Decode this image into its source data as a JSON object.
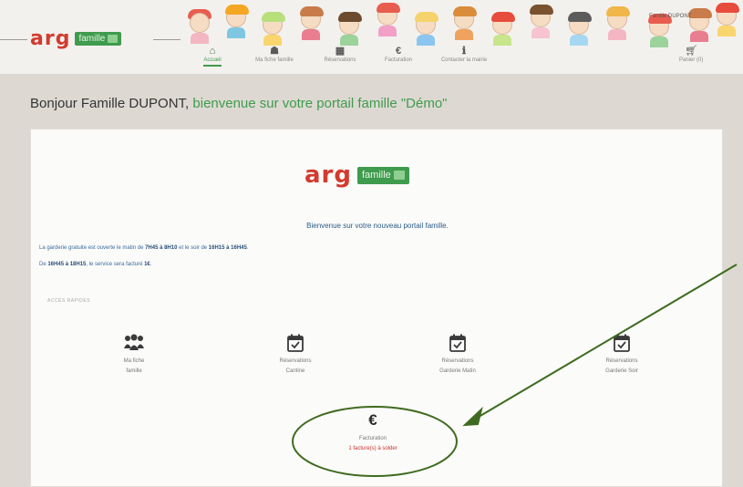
{
  "header": {
    "logo_word": "arg",
    "logo_badge": "famille",
    "user_name": "Famille DUPONT",
    "nav": [
      {
        "label": "Accueil",
        "icon": "home-icon",
        "active": true
      },
      {
        "label": "Ma fiche famille",
        "icon": "family-icon",
        "active": false
      },
      {
        "label": "Réservations",
        "icon": "calendar-icon",
        "active": false
      },
      {
        "label": "Facturation",
        "icon": "euro-icon",
        "active": false
      },
      {
        "label": "Contacter la mairie",
        "icon": "info-icon",
        "active": false
      }
    ],
    "cart_label": "Panier (0)"
  },
  "greeting": {
    "prefix": "Bonjour Famille DUPONT,",
    "suffix": "bienvenue sur votre portail famille \"Démo\""
  },
  "main": {
    "logo_word": "arg",
    "logo_badge": "famille",
    "welcome": "Bienvenue sur votre nouveau portail famille.",
    "info1": {
      "a": "La garderie gratuite est ouverte le matin de ",
      "b": "7H45 à 8H10",
      "c": " et le soir de ",
      "d": "16H15 à 16H45",
      "e": "."
    },
    "info2": {
      "a": "De ",
      "b": "16H45 à 18H15",
      "c": ", le service sera facturé ",
      "d": "1€",
      "e": "."
    },
    "quick_access": "ACCÈS RAPIDES",
    "tiles": [
      {
        "line1": "Ma fiche",
        "line2": "famille",
        "icon": "family-icon"
      },
      {
        "line1": "Réservations",
        "line2": "Cantine",
        "icon": "calendar-check-icon"
      },
      {
        "line1": "Réservations",
        "line2": "Garderie Matin",
        "icon": "calendar-check-icon"
      },
      {
        "line1": "Réservations",
        "line2": "Garderie Soir",
        "icon": "calendar-check-icon"
      }
    ],
    "billing": {
      "icon_glyph": "€",
      "label": "Facturation",
      "status": "1 facture(s) à solder"
    }
  },
  "colors": {
    "brand_green": "#3f9b4d",
    "annotation_green": "#3e6b1f",
    "alert_red": "#c8312c"
  }
}
